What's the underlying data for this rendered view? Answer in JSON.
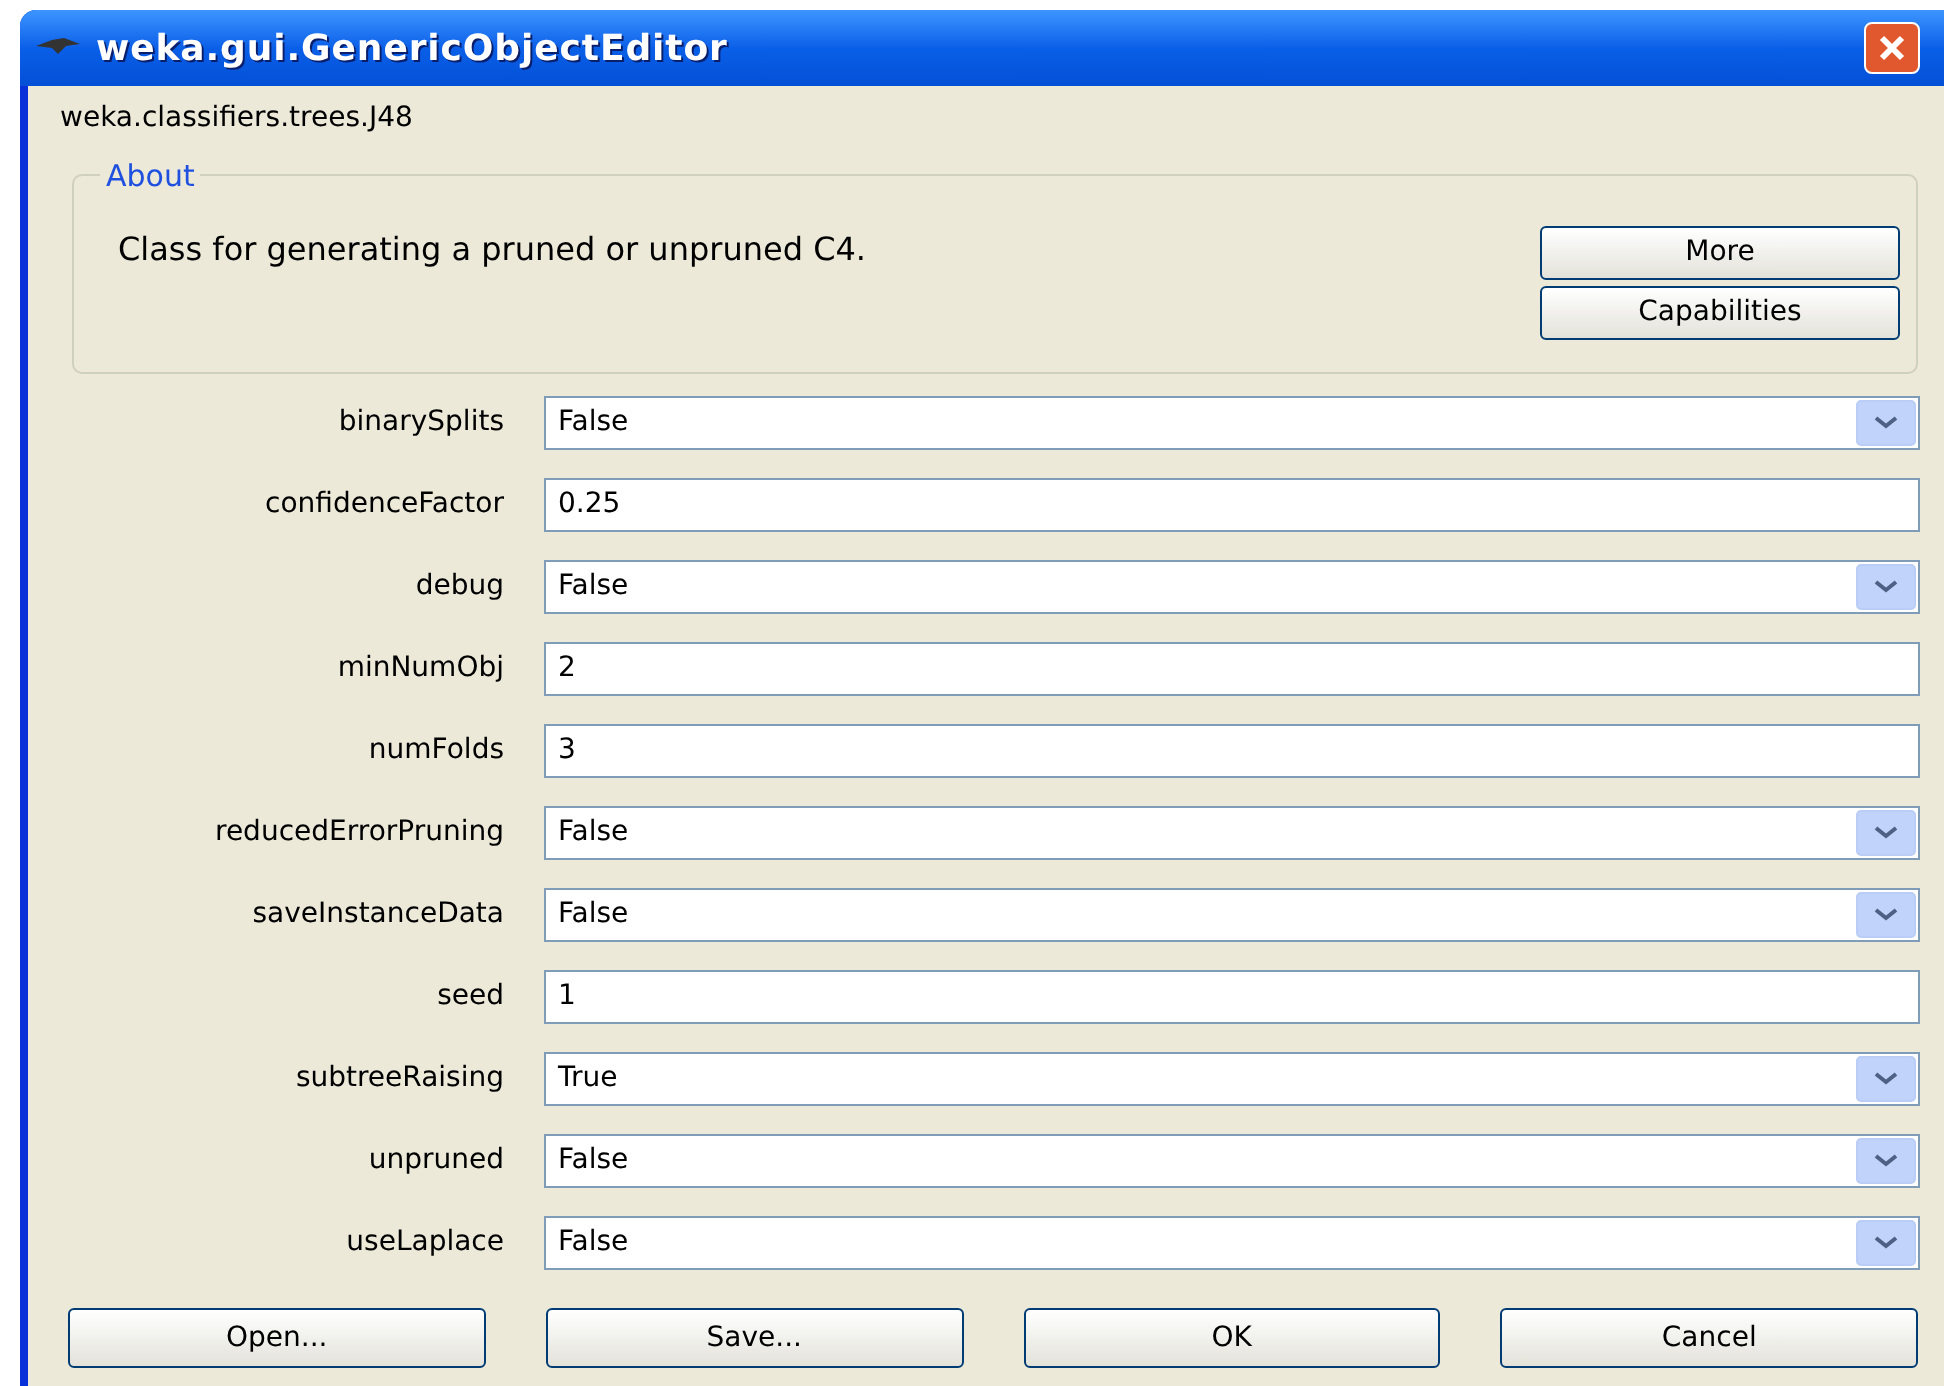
{
  "window": {
    "title": "weka.gui.GenericObjectEditor"
  },
  "class_name": "weka.classifiers.trees.J48",
  "about": {
    "legend": "About",
    "text": "Class for generating a pruned or unpruned C4.",
    "buttons": [
      "More",
      "Capabilities"
    ]
  },
  "properties": [
    {
      "label": "binarySplits",
      "kind": "combo",
      "value": "False"
    },
    {
      "label": "confidenceFactor",
      "kind": "text",
      "value": "0.25"
    },
    {
      "label": "debug",
      "kind": "combo",
      "value": "False"
    },
    {
      "label": "minNumObj",
      "kind": "text",
      "value": "2"
    },
    {
      "label": "numFolds",
      "kind": "text",
      "value": "3"
    },
    {
      "label": "reducedErrorPruning",
      "kind": "combo",
      "value": "False"
    },
    {
      "label": "saveInstanceData",
      "kind": "combo",
      "value": "False"
    },
    {
      "label": "seed",
      "kind": "text",
      "value": "1"
    },
    {
      "label": "subtreeRaising",
      "kind": "combo",
      "value": "True"
    },
    {
      "label": "unpruned",
      "kind": "combo",
      "value": "False"
    },
    {
      "label": "useLaplace",
      "kind": "combo",
      "value": "False"
    }
  ],
  "buttons": [
    "Open...",
    "Save...",
    "OK",
    "Cancel"
  ]
}
